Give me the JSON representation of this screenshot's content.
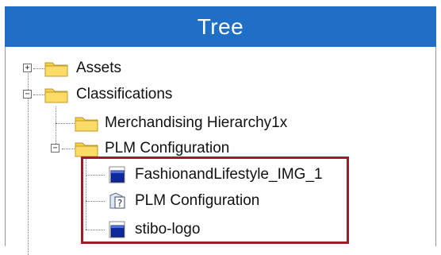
{
  "header": {
    "title": "Tree"
  },
  "tree": {
    "items": [
      {
        "label": "Assets",
        "expander": "+"
      },
      {
        "label": "Classifications",
        "expander": "−"
      },
      {
        "label": "Merchandising Hierarchy1x"
      },
      {
        "label": "PLM Configuration",
        "expander": "−"
      },
      {
        "label": "FashionandLifestyle_IMG_1",
        "icon": "image-asset-icon"
      },
      {
        "label": "PLM Configuration",
        "icon": "unknown-document-icon"
      },
      {
        "label": "stibo-logo",
        "icon": "image-asset-icon"
      }
    ]
  },
  "colors": {
    "header_bg": "#1f6fc6",
    "highlight": "#9b1c2a",
    "folder": "#f5cf4a"
  }
}
